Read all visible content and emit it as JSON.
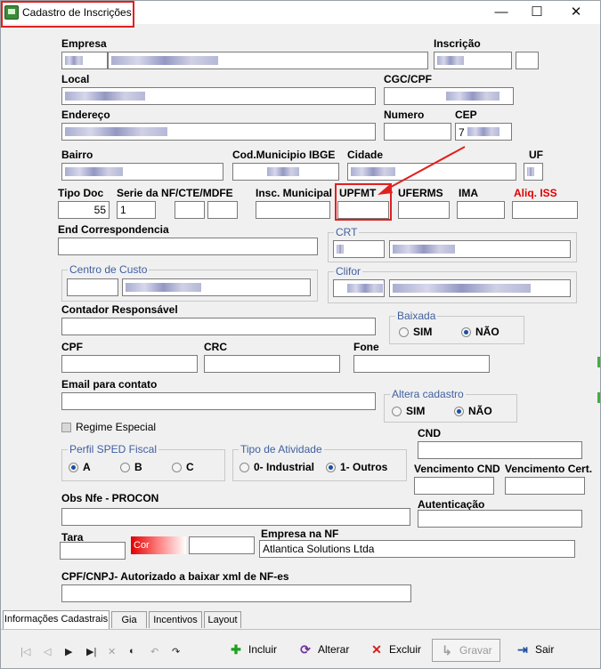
{
  "window": {
    "title": "Cadastro de Inscrições",
    "min": "—",
    "max": "☐",
    "close": "✕"
  },
  "fields": {
    "empresa": {
      "label": "Empresa"
    },
    "inscricao": {
      "label": "Inscrição"
    },
    "local": {
      "label": "Local"
    },
    "cgc": {
      "label": "CGC/CPF"
    },
    "endereco": {
      "label": "Endereço"
    },
    "numero": {
      "label": "Numero"
    },
    "cep": {
      "label": "CEP",
      "value": "7"
    },
    "bairro": {
      "label": "Bairro"
    },
    "cod_municipio": {
      "label": "Cod.Municipio IBGE"
    },
    "cidade": {
      "label": "Cidade"
    },
    "uf": {
      "label": "UF"
    },
    "tipo_doc": {
      "label": "Tipo Doc",
      "value": "55"
    },
    "serie": {
      "label": "Serie da NF/CTE/MDFE",
      "value": "1"
    },
    "insc_municipal": {
      "label": "Insc. Municipal"
    },
    "upfmt": {
      "label": "UPFMT"
    },
    "uferms": {
      "label": "UFERMS"
    },
    "ima": {
      "label": "IMA"
    },
    "aliq_iss": {
      "label": "Aliq. ISS"
    },
    "end_corresp": {
      "label": "End Correspondencia"
    },
    "crt": {
      "label": "CRT"
    },
    "centro_custo": {
      "label": "Centro de Custo"
    },
    "clifor": {
      "label": "Clifor"
    },
    "contador": {
      "label": "Contador Responsável"
    },
    "baixada": {
      "label": "Baixada",
      "opt1": "SIM",
      "opt2": "NÃO",
      "selected": "NÃO"
    },
    "cpf": {
      "label": "CPF"
    },
    "crc": {
      "label": "CRC"
    },
    "fone": {
      "label": "Fone"
    },
    "email": {
      "label": "Email para contato"
    },
    "altera": {
      "label": "Altera cadastro",
      "opt1": "SIM",
      "opt2": "NÃO",
      "selected": "NÃO"
    },
    "regime": {
      "label": "Regime Especial"
    },
    "cnd": {
      "label": "CND"
    },
    "perfil": {
      "label": "Perfil SPED Fiscal",
      "opt1": "A",
      "opt2": "B",
      "opt3": "C",
      "selected": "A"
    },
    "atividade": {
      "label": "Tipo de Atividade",
      "opt1": "0- Industrial",
      "opt2": "1- Outros",
      "selected": "1- Outros"
    },
    "venc_cnd": {
      "label": "Vencimento CND"
    },
    "venc_cert": {
      "label": "Vencimento Cert."
    },
    "obs": {
      "label": "Obs Nfe - PROCON"
    },
    "autenticacao": {
      "label": "Autenticação"
    },
    "tara": {
      "label": "Tara"
    },
    "cor": {
      "label": "Cor"
    },
    "empresa_nf": {
      "label": "Empresa na NF",
      "value": "Atlantica Solutions Ltda"
    },
    "cpf_cnpj": {
      "label": "CPF/CNPJ- Autorizado a baixar xml de NF-es"
    }
  },
  "tabs": [
    "Informações Cadastrais",
    "Gia",
    "Incentivos",
    "Layout"
  ],
  "toolbar": {
    "incluir": "Incluir",
    "alterar": "Alterar",
    "excluir": "Excluir",
    "gravar": "Gravar",
    "sair": "Sair",
    "nav": [
      "|◁",
      "◁",
      "▶",
      "▶|",
      "✕",
      "◐",
      "↶",
      "↷"
    ]
  },
  "colors": {
    "highlight": "#e02020",
    "accent_label": "#e00000",
    "group_title": "#4060a0"
  }
}
